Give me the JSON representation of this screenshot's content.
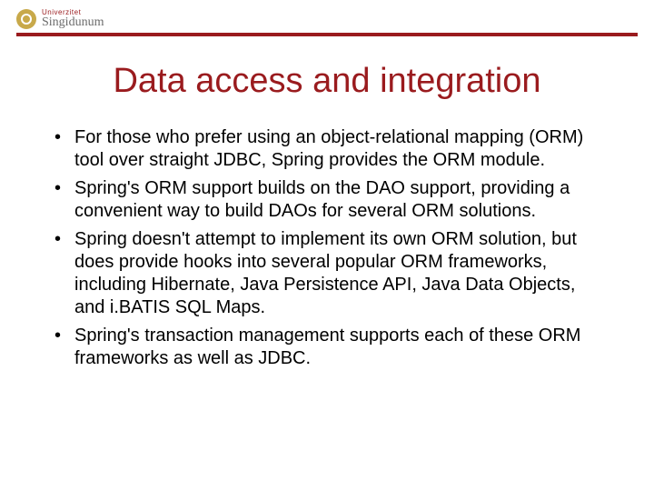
{
  "logo": {
    "top": "Univerzitet",
    "name": "Singidunum"
  },
  "title": "Data access and integration",
  "bullets": [
    "For those who prefer using an object-relational mapping (ORM) tool over straight JDBC, Spring provides the ORM module.",
    "Spring's ORM support builds on the DAO support, providing a convenient way to build DAOs for several ORM solutions.",
    "Spring doesn't attempt to implement its own ORM solution, but does provide hooks into several popular ORM frameworks, including Hibernate, Java Persistence API, Java Data Objects, and i.BATIS SQL Maps.",
    "Spring's transaction management supports each of these ORM frameworks as well as JDBC."
  ]
}
